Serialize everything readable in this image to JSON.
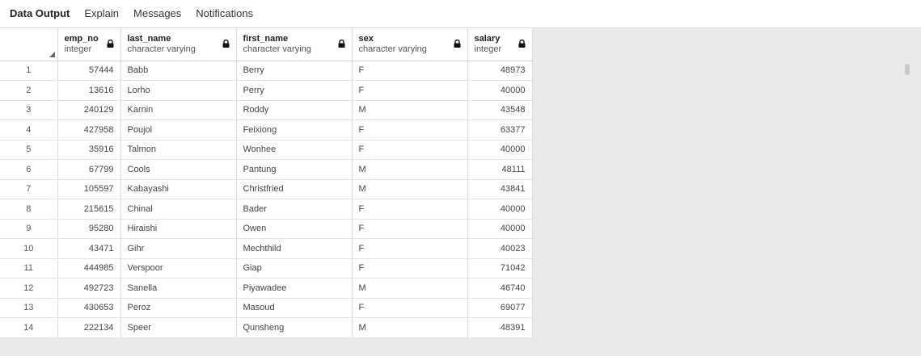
{
  "tabs": [
    {
      "label": "Data Output",
      "active": true
    },
    {
      "label": "Explain",
      "active": false
    },
    {
      "label": "Messages",
      "active": false
    },
    {
      "label": "Notifications",
      "active": false
    }
  ],
  "columns": [
    {
      "name": "emp_no",
      "type": "integer"
    },
    {
      "name": "last_name",
      "type": "character varying"
    },
    {
      "name": "first_name",
      "type": "character varying"
    },
    {
      "name": "sex",
      "type": "character varying"
    },
    {
      "name": "salary",
      "type": "integer"
    }
  ],
  "rows": [
    {
      "n": "1",
      "emp_no": "57444",
      "last_name": "Babb",
      "first_name": "Berry",
      "sex": "F",
      "salary": "48973"
    },
    {
      "n": "2",
      "emp_no": "13616",
      "last_name": "Lorho",
      "first_name": "Perry",
      "sex": "F",
      "salary": "40000"
    },
    {
      "n": "3",
      "emp_no": "240129",
      "last_name": "Karnin",
      "first_name": "Roddy",
      "sex": "M",
      "salary": "43548"
    },
    {
      "n": "4",
      "emp_no": "427958",
      "last_name": "Poujol",
      "first_name": "Feixiong",
      "sex": "F",
      "salary": "63377"
    },
    {
      "n": "5",
      "emp_no": "35916",
      "last_name": "Talmon",
      "first_name": "Wonhee",
      "sex": "F",
      "salary": "40000"
    },
    {
      "n": "6",
      "emp_no": "67799",
      "last_name": "Cools",
      "first_name": "Pantung",
      "sex": "M",
      "salary": "48111"
    },
    {
      "n": "7",
      "emp_no": "105597",
      "last_name": "Kabayashi",
      "first_name": "Christfried",
      "sex": "M",
      "salary": "43841"
    },
    {
      "n": "8",
      "emp_no": "215615",
      "last_name": "Chinal",
      "first_name": "Bader",
      "sex": "F",
      "salary": "40000"
    },
    {
      "n": "9",
      "emp_no": "95280",
      "last_name": "Hiraishi",
      "first_name": "Owen",
      "sex": "F",
      "salary": "40000"
    },
    {
      "n": "10",
      "emp_no": "43471",
      "last_name": "Gihr",
      "first_name": "Mechthild",
      "sex": "F",
      "salary": "40023"
    },
    {
      "n": "11",
      "emp_no": "444985",
      "last_name": "Verspoor",
      "first_name": "Giap",
      "sex": "F",
      "salary": "71042"
    },
    {
      "n": "12",
      "emp_no": "492723",
      "last_name": "Sanella",
      "first_name": "Piyawadee",
      "sex": "M",
      "salary": "46740"
    },
    {
      "n": "13",
      "emp_no": "430653",
      "last_name": "Peroz",
      "first_name": "Masoud",
      "sex": "F",
      "salary": "69077"
    },
    {
      "n": "14",
      "emp_no": "222134",
      "last_name": "Speer",
      "first_name": "Qunsheng",
      "sex": "M",
      "salary": "48391"
    }
  ]
}
